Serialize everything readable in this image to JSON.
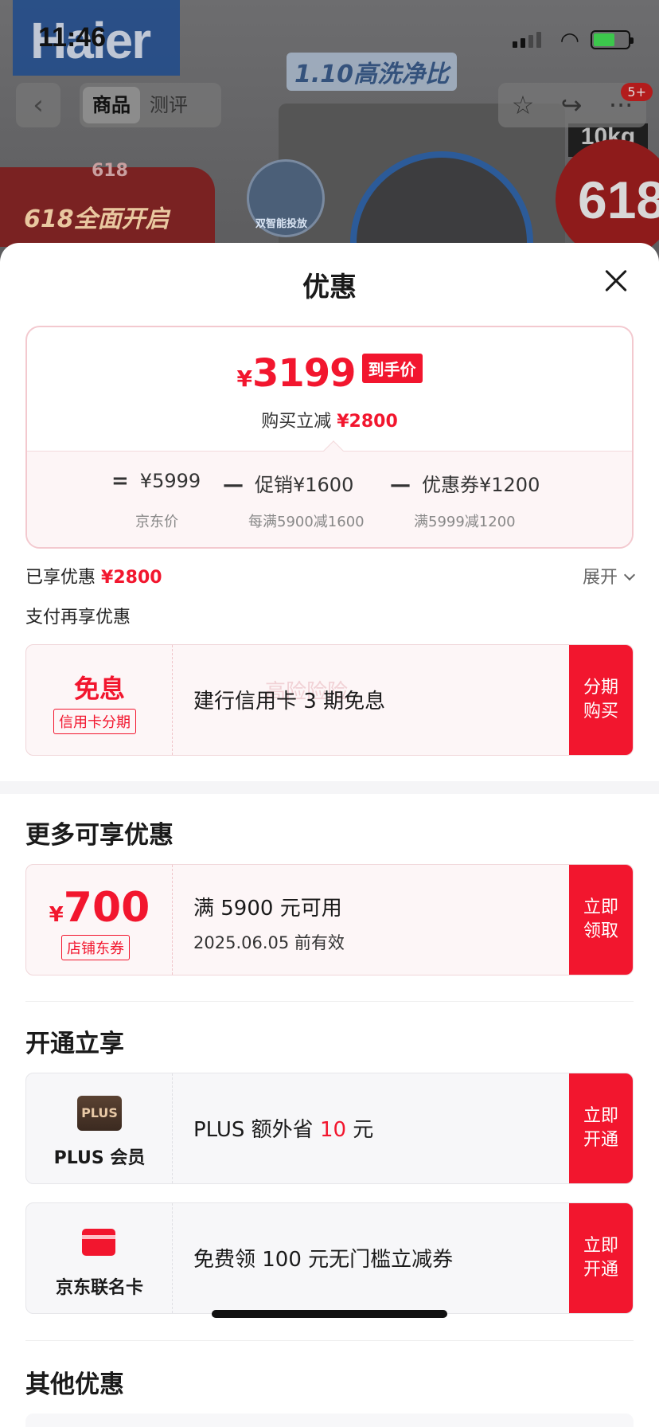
{
  "status_bar": {
    "time": "11:46"
  },
  "background": {
    "brand": "Haier",
    "ratio_text": "1.10高洗净比",
    "promo_text": "618全面开启",
    "promo_tag": "618",
    "badge_618": "618",
    "capacity": "10kg",
    "smart_label": "双智能投放",
    "cart_badge": "5+"
  },
  "nav": {
    "back_icon": "‹",
    "tabs": [
      {
        "label": "商品"
      },
      {
        "label": "测评"
      }
    ],
    "star_icon": "☆",
    "share_icon": "↪",
    "more_icon": "···"
  },
  "sheet": {
    "title": "优惠",
    "price": {
      "currency": "¥",
      "final": "3199",
      "final_tag": "到手价",
      "reduce_label": "购买立减",
      "reduce_value": "¥2800",
      "jd_price": "¥5999",
      "jd_label": "京东价",
      "promo_label": "促销¥1600",
      "promo_note": "每满5900减1600",
      "coupon_label": "优惠券¥1200",
      "coupon_note": "满5999减1200",
      "eq": "=",
      "minus": "—"
    },
    "enjoyed_label": "已享优惠",
    "enjoyed_value": "¥2800",
    "expand_label": "展开",
    "pay_title": "支付再享优惠",
    "installment": {
      "title": "免息",
      "tag": "信用卡分期",
      "desc": "建行信用卡 3 期免息",
      "watermark": "高险险险",
      "action": "分期购买"
    },
    "more_title": "更多可享优惠",
    "coupon": {
      "currency": "¥",
      "amount": "700",
      "tag": "店铺东券",
      "desc": "满 5900 元可用",
      "valid": "2025.06.05 前有效",
      "action": "立即领取"
    },
    "open_title": "开通立享",
    "plus": {
      "logo": "PLUS",
      "label": "PLUS 会员",
      "desc_pre": "PLUS 额外省 ",
      "desc_num": "10",
      "desc_post": " 元",
      "action": "立即开通"
    },
    "jdcard": {
      "label": "京东联名卡",
      "desc": "免费领 100 元无门槛立减券",
      "action": "立即开通"
    },
    "other_title": "其他优惠"
  }
}
